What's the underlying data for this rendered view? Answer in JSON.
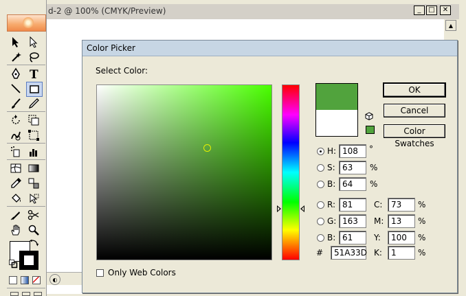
{
  "document": {
    "title": "d-2 @ 100% (CMYK/Preview)",
    "minimize_label": "_",
    "maximize_label": "□",
    "close_label": "✕"
  },
  "color_picker": {
    "title": "Color Picker",
    "select_label": "Select Color:",
    "buttons": {
      "ok": "OK",
      "cancel": "Cancel",
      "swatches": "Color Swatches"
    },
    "new_color": "#51A33D",
    "current_color": "#FFFFFF",
    "hue_field_color": "#49FF00",
    "hsb": {
      "h_label": "H:",
      "h": "108",
      "h_unit": "°",
      "s_label": "S:",
      "s": "63",
      "s_unit": "%",
      "b_label": "B:",
      "b": "64",
      "b_unit": "%"
    },
    "rgb": {
      "r_label": "R:",
      "r": "81",
      "g_label": "G:",
      "g": "163",
      "b_label": "B:",
      "b": "61"
    },
    "hex": {
      "label": "#",
      "value": "51A33D"
    },
    "cmyk": {
      "c_label": "C:",
      "c": "73",
      "m_label": "M:",
      "m": "13",
      "y_label": "Y:",
      "y": "100",
      "k_label": "K:",
      "k": "1",
      "unit": "%"
    },
    "only_web_colors": "Only Web Colors",
    "selected_mode": "H"
  },
  "tools": {
    "icons": [
      "selection-icon",
      "direct-selection-icon",
      "magic-wand-icon",
      "lasso-icon",
      "pen-icon",
      "type-icon",
      "line-icon",
      "rectangle-icon",
      "paintbrush-icon",
      "pencil-icon",
      "rotate-icon",
      "scale-icon",
      "warp-icon",
      "free-transform-icon",
      "symbol-sprayer-icon",
      "graph-icon",
      "mesh-icon",
      "gradient-icon",
      "eyedropper-icon",
      "blend-icon",
      "live-paint-icon",
      "live-paint-selection-icon",
      "slice-icon",
      "scissors-icon",
      "hand-icon",
      "zoom-icon"
    ]
  }
}
